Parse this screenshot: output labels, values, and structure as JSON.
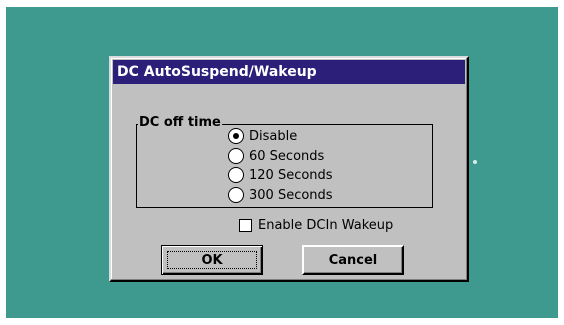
{
  "dialog": {
    "title": "DC AutoSuspend/Wakeup",
    "group_label": "DC off time",
    "options": [
      {
        "label": "Disable",
        "checked": true
      },
      {
        "label": "60 Seconds",
        "checked": false
      },
      {
        "label": "120 Seconds",
        "checked": false
      },
      {
        "label": "300 Seconds",
        "checked": false
      }
    ],
    "wakeup_checkbox": {
      "label": "Enable DCIn Wakeup",
      "checked": false
    },
    "ok_label": "OK",
    "cancel_label": "Cancel"
  }
}
